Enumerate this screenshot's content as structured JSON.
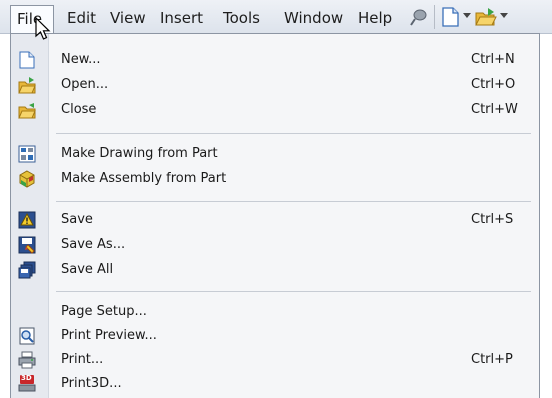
{
  "menubar": {
    "items": [
      "File",
      "Edit",
      "View",
      "Insert",
      "Tools",
      "Window",
      "Help"
    ]
  },
  "toolbar_icons": [
    "pushpin-icon",
    "new-document-icon",
    "dropdown-arrow-icon",
    "open-folder-icon",
    "dropdown-arrow-icon"
  ],
  "file_menu": {
    "items": [
      {
        "label": "New...",
        "shortcut": "Ctrl+N",
        "icon": "new-document-icon"
      },
      {
        "label": "Open...",
        "shortcut": "Ctrl+O",
        "icon": "open-folder-icon"
      },
      {
        "label": "Close",
        "shortcut": "Ctrl+W",
        "icon": "close-folder-icon"
      },
      {
        "label": "Make Drawing from Part",
        "shortcut": "",
        "icon": "make-drawing-icon"
      },
      {
        "label": "Make Assembly from Part",
        "shortcut": "",
        "icon": "make-assembly-icon"
      },
      {
        "label": "Save",
        "shortcut": "Ctrl+S",
        "icon": "save-icon"
      },
      {
        "label": "Save As...",
        "shortcut": "",
        "icon": "save-as-icon"
      },
      {
        "label": "Save All",
        "shortcut": "",
        "icon": "save-all-icon"
      },
      {
        "label": "Page Setup...",
        "shortcut": "",
        "icon": ""
      },
      {
        "label": "Print Preview...",
        "shortcut": "",
        "icon": "print-preview-icon"
      },
      {
        "label": "Print...",
        "shortcut": "Ctrl+P",
        "icon": "printer-icon"
      },
      {
        "label": "Print3D...",
        "shortcut": "",
        "icon": "print3d-icon"
      }
    ]
  },
  "colors": {
    "menubar_bg": "#e3e8ef",
    "menu_bg": "#f5f6f8",
    "gutter_bg": "#e6e9ef",
    "separator": "#c7ccd4"
  }
}
